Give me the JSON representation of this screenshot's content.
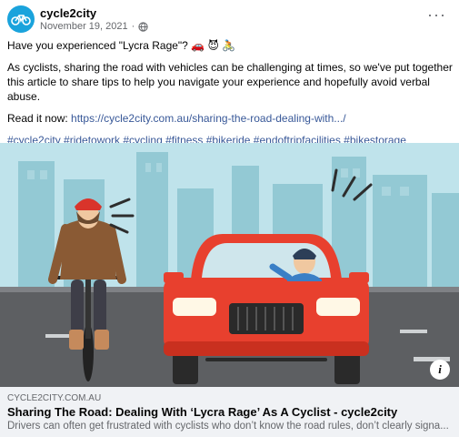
{
  "post": {
    "page_name": "cycle2city",
    "date": "November 19, 2021",
    "separator": "·",
    "more_label": "···",
    "question": "Have you experienced \"Lycra Rage\"? 🚗 😈 🚴",
    "paragraph": "As cyclists, sharing the road with vehicles can be challenging at times, so we've put together this article to share tips to help you navigate your experience and hopefully avoid verbal abuse.",
    "read_label": "Read it now: ",
    "read_link": "https://cycle2city.com.au/sharing-the-road-dealing-with.../",
    "hashtags": "#cycle2city #ridetowork #cycling #fitness #bikeride #endoftripfacilities #bikestorage #bikeparking #brisbaneride"
  },
  "media": {
    "info_label": "i"
  },
  "card": {
    "domain": "CYCLE2CITY.COM.AU",
    "title": "Sharing The Road: Dealing With ‘Lycra Rage’ As A Cyclist - cycle2city",
    "description": "Drivers can often get frustrated with cyclists who don’t know the road rules, don’t clearly signa..."
  },
  "colors": {
    "link": "#385898",
    "car": "#e8402e",
    "sky": "#bfe3eb",
    "buildings": "#93c9d4",
    "road": "#5d5f62"
  },
  "icons": [
    "cycle2city-logo-icon",
    "globe-icon",
    "more-options-icon",
    "info-icon"
  ]
}
